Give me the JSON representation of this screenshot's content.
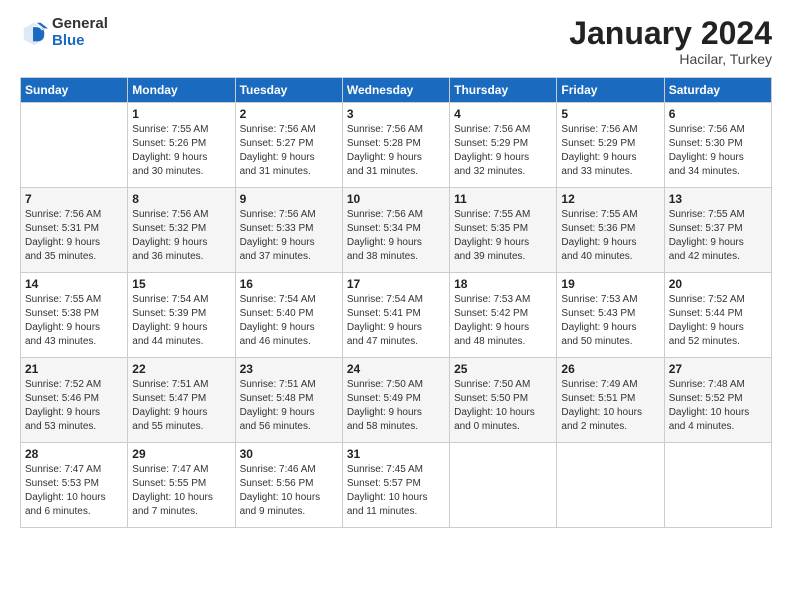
{
  "header": {
    "logo_general": "General",
    "logo_blue": "Blue",
    "month_title": "January 2024",
    "subtitle": "Hacilar, Turkey"
  },
  "days_of_week": [
    "Sunday",
    "Monday",
    "Tuesday",
    "Wednesday",
    "Thursday",
    "Friday",
    "Saturday"
  ],
  "weeks": [
    [
      {
        "day": "",
        "info": ""
      },
      {
        "day": "1",
        "info": "Sunrise: 7:55 AM\nSunset: 5:26 PM\nDaylight: 9 hours\nand 30 minutes."
      },
      {
        "day": "2",
        "info": "Sunrise: 7:56 AM\nSunset: 5:27 PM\nDaylight: 9 hours\nand 31 minutes."
      },
      {
        "day": "3",
        "info": "Sunrise: 7:56 AM\nSunset: 5:28 PM\nDaylight: 9 hours\nand 31 minutes."
      },
      {
        "day": "4",
        "info": "Sunrise: 7:56 AM\nSunset: 5:29 PM\nDaylight: 9 hours\nand 32 minutes."
      },
      {
        "day": "5",
        "info": "Sunrise: 7:56 AM\nSunset: 5:29 PM\nDaylight: 9 hours\nand 33 minutes."
      },
      {
        "day": "6",
        "info": "Sunrise: 7:56 AM\nSunset: 5:30 PM\nDaylight: 9 hours\nand 34 minutes."
      }
    ],
    [
      {
        "day": "7",
        "info": "Sunrise: 7:56 AM\nSunset: 5:31 PM\nDaylight: 9 hours\nand 35 minutes."
      },
      {
        "day": "8",
        "info": "Sunrise: 7:56 AM\nSunset: 5:32 PM\nDaylight: 9 hours\nand 36 minutes."
      },
      {
        "day": "9",
        "info": "Sunrise: 7:56 AM\nSunset: 5:33 PM\nDaylight: 9 hours\nand 37 minutes."
      },
      {
        "day": "10",
        "info": "Sunrise: 7:56 AM\nSunset: 5:34 PM\nDaylight: 9 hours\nand 38 minutes."
      },
      {
        "day": "11",
        "info": "Sunrise: 7:55 AM\nSunset: 5:35 PM\nDaylight: 9 hours\nand 39 minutes."
      },
      {
        "day": "12",
        "info": "Sunrise: 7:55 AM\nSunset: 5:36 PM\nDaylight: 9 hours\nand 40 minutes."
      },
      {
        "day": "13",
        "info": "Sunrise: 7:55 AM\nSunset: 5:37 PM\nDaylight: 9 hours\nand 42 minutes."
      }
    ],
    [
      {
        "day": "14",
        "info": "Sunrise: 7:55 AM\nSunset: 5:38 PM\nDaylight: 9 hours\nand 43 minutes."
      },
      {
        "day": "15",
        "info": "Sunrise: 7:54 AM\nSunset: 5:39 PM\nDaylight: 9 hours\nand 44 minutes."
      },
      {
        "day": "16",
        "info": "Sunrise: 7:54 AM\nSunset: 5:40 PM\nDaylight: 9 hours\nand 46 minutes."
      },
      {
        "day": "17",
        "info": "Sunrise: 7:54 AM\nSunset: 5:41 PM\nDaylight: 9 hours\nand 47 minutes."
      },
      {
        "day": "18",
        "info": "Sunrise: 7:53 AM\nSunset: 5:42 PM\nDaylight: 9 hours\nand 48 minutes."
      },
      {
        "day": "19",
        "info": "Sunrise: 7:53 AM\nSunset: 5:43 PM\nDaylight: 9 hours\nand 50 minutes."
      },
      {
        "day": "20",
        "info": "Sunrise: 7:52 AM\nSunset: 5:44 PM\nDaylight: 9 hours\nand 52 minutes."
      }
    ],
    [
      {
        "day": "21",
        "info": "Sunrise: 7:52 AM\nSunset: 5:46 PM\nDaylight: 9 hours\nand 53 minutes."
      },
      {
        "day": "22",
        "info": "Sunrise: 7:51 AM\nSunset: 5:47 PM\nDaylight: 9 hours\nand 55 minutes."
      },
      {
        "day": "23",
        "info": "Sunrise: 7:51 AM\nSunset: 5:48 PM\nDaylight: 9 hours\nand 56 minutes."
      },
      {
        "day": "24",
        "info": "Sunrise: 7:50 AM\nSunset: 5:49 PM\nDaylight: 9 hours\nand 58 minutes."
      },
      {
        "day": "25",
        "info": "Sunrise: 7:50 AM\nSunset: 5:50 PM\nDaylight: 10 hours\nand 0 minutes."
      },
      {
        "day": "26",
        "info": "Sunrise: 7:49 AM\nSunset: 5:51 PM\nDaylight: 10 hours\nand 2 minutes."
      },
      {
        "day": "27",
        "info": "Sunrise: 7:48 AM\nSunset: 5:52 PM\nDaylight: 10 hours\nand 4 minutes."
      }
    ],
    [
      {
        "day": "28",
        "info": "Sunrise: 7:47 AM\nSunset: 5:53 PM\nDaylight: 10 hours\nand 6 minutes."
      },
      {
        "day": "29",
        "info": "Sunrise: 7:47 AM\nSunset: 5:55 PM\nDaylight: 10 hours\nand 7 minutes."
      },
      {
        "day": "30",
        "info": "Sunrise: 7:46 AM\nSunset: 5:56 PM\nDaylight: 10 hours\nand 9 minutes."
      },
      {
        "day": "31",
        "info": "Sunrise: 7:45 AM\nSunset: 5:57 PM\nDaylight: 10 hours\nand 11 minutes."
      },
      {
        "day": "",
        "info": ""
      },
      {
        "day": "",
        "info": ""
      },
      {
        "day": "",
        "info": ""
      }
    ]
  ]
}
